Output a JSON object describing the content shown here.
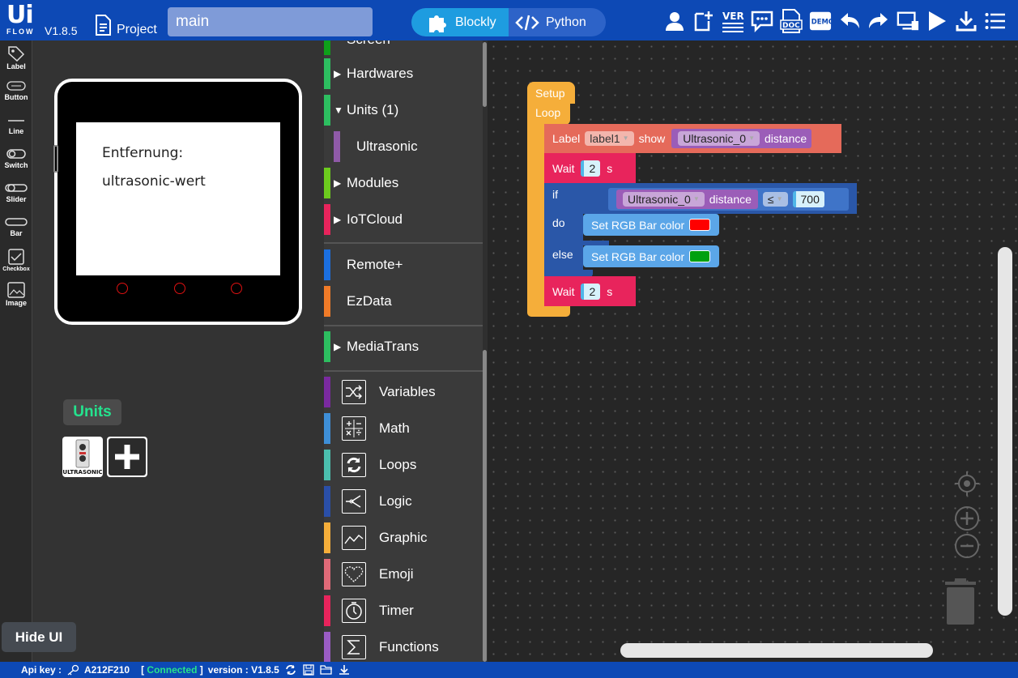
{
  "header": {
    "logo_top": "Ui",
    "logo_bottom": "FLOW",
    "version": "V1.8.5",
    "project_label": "Project",
    "project_name": "main",
    "mode_blockly": "Blockly",
    "mode_python": "Python",
    "tools": [
      "user-icon",
      "new-file-icon",
      "version-icon",
      "comment-icon",
      "doc-icon",
      "demo-icon",
      "undo-icon",
      "redo-icon",
      "device-manager-icon",
      "run-icon",
      "download-icon",
      "menu-icon"
    ],
    "ver_label": "VER.",
    "doc_label": "DOC",
    "demo_label": "DEMO"
  },
  "components": [
    {
      "label": "Label",
      "icon": "tag-icon"
    },
    {
      "label": "Button",
      "icon": "button-icon"
    },
    {
      "label": "Line",
      "icon": "line-icon"
    },
    {
      "label": "Switch",
      "icon": "switch-icon"
    },
    {
      "label": "Slider",
      "icon": "slider-icon"
    },
    {
      "label": "Bar",
      "icon": "bar-icon"
    },
    {
      "label": "Checkbox",
      "icon": "checkbox-icon"
    },
    {
      "label": "Image",
      "icon": "image-icon"
    }
  ],
  "device": {
    "label1": "Entfernung:",
    "label2": "ultrasonic-wert"
  },
  "units_panel": {
    "title": "Units",
    "unit_name": "ULTRASONIC"
  },
  "hide_ui": "Hide UI",
  "toolbox": {
    "partial_top": "Screen",
    "categories": [
      {
        "label": "Hardwares",
        "color": "#2dbe60"
      },
      {
        "label": "Units (1)",
        "color": "#2dbe60"
      },
      {
        "label": "Ultrasonic",
        "color": "#8f5aa8"
      },
      {
        "label": "Modules",
        "color": "#6ccb1e"
      },
      {
        "label": "IoTCloud",
        "color": "#e8245c"
      },
      {
        "label": "Remote+",
        "color": "#1b6fe0"
      },
      {
        "label": "EzData",
        "color": "#f07b28"
      },
      {
        "label": "MediaTrans",
        "color": "#2dbe60"
      },
      {
        "label": "Variables",
        "color": "#7a2aa0"
      },
      {
        "label": "Math",
        "color": "#3e8fd8"
      },
      {
        "label": "Loops",
        "color": "#4bbfae"
      },
      {
        "label": "Logic",
        "color": "#2a4fa8"
      },
      {
        "label": "Graphic",
        "color": "#f5ae3a"
      },
      {
        "label": "Emoji",
        "color": "#e06a78"
      },
      {
        "label": "Timer",
        "color": "#e8245c"
      },
      {
        "label": "Functions",
        "color": "#9a5cc4"
      }
    ]
  },
  "blocks": {
    "setup": "Setup",
    "loop": "Loop",
    "label_kw": "Label",
    "label_var": "label1",
    "show_kw": "show",
    "sensor": "Ultrasonic_0",
    "distance_kw": "distance",
    "wait_kw": "Wait",
    "wait_val1": "2",
    "wait_unit": "s",
    "if_kw": "if",
    "compare_op": "≤",
    "compare_val": "700",
    "do_kw": "do",
    "else_kw": "else",
    "rgb_text": "Set RGB Bar color",
    "rgb_color_do": "#ff0000",
    "rgb_color_else": "#00a010",
    "wait_val2": "2"
  },
  "status": {
    "apikey_label": "Api key :",
    "apikey_value": "A212F210",
    "connected": "Connected",
    "version_text": "version : V1.8.5"
  }
}
